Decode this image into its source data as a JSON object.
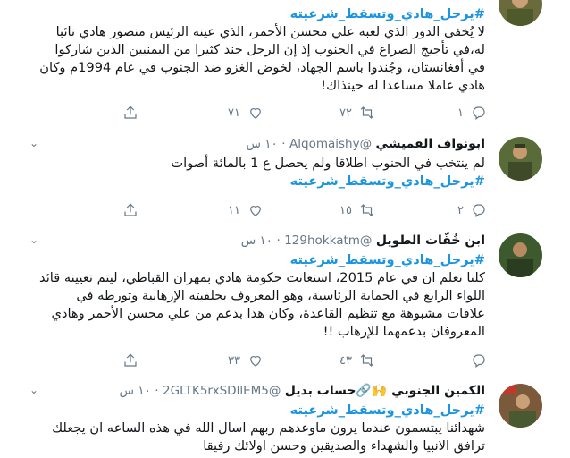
{
  "tweets": [
    {
      "name": "",
      "handle": "",
      "time": "",
      "hashtag": "#يرحل_هادي_وتسقط_شرعيته",
      "body": "لا يُخفى الدور الذي لعبه علي محسن الأحمر، الذي عينه الرئيس منصور هادي نائبا له،في تأجيج الصراع في الجنوب إذ إن الرجل جند كثيرا من اليمنيين الذين شاركوا في أفغانستان، وجُندوا باسم الجهاد، لخوض الغزو ضد الجنوب في عام 1994م وكان هادي عاملا مساعدا له حينذاك!",
      "body_after_hashtag": "",
      "reply_count": "١",
      "retweet_count": "٧٢",
      "like_count": "٧١",
      "avatar_color": "#6b6a3c"
    },
    {
      "name": "ابونواف القميشي",
      "handle": "@Alqomaishy",
      "time": "١٠ س",
      "hashtag": "#يرحل_هادي_وتسقط_شرعيته",
      "body": "لم ينتخب في الجنوب اطلاقا ولم يحصل ع 1 بالمائة أصوات",
      "body_after_hashtag": "",
      "reply_count": "٢",
      "retweet_count": "١٥",
      "like_count": "١١",
      "avatar_color": "#5a6b3a"
    },
    {
      "name": "ابن خُقّات الطويل",
      "handle": "@129hokkatm",
      "time": "١٠ س",
      "hashtag": "#يرحل_هادي_وتسقط_شرعيته",
      "body": "كلنا نعلم ان في عام 2015، استعانت حكومة هادي بمهران القباطي، ليتم تعيينه قائد اللواء الرابع في الحماية الرئاسية، وهو المعروف بخلفيته الإرهابية وتورطه في علاقات مشبوهة مع تنظيم القاعدة، وكان هذا بدعم من علي محسن الأحمر وهادي المعروفان بدعمهما للإرهاب !!",
      "body_after_hashtag": "",
      "reply_count": "",
      "retweet_count": "٤٣",
      "like_count": "٣٣",
      "avatar_color": "#3d5a2e"
    },
    {
      "name": "الكمين الجنوبي 🙌🔗حساب بديل",
      "handle": "@2GLTK5rxSDllEM5",
      "time": "١٠ س",
      "hashtag": "#يرحل_هادي_وتسقط_شرعيته",
      "body": "",
      "body_after_hashtag": "شهدائنا يبتسمون عندما يرون ماوعدهم ربهم اسال الله في هذه الساعه ان يجعلك ترافق الانبيا والشهداء والصديقين وحسن اولائك رفيقا",
      "reply_count": "",
      "retweet_count": "",
      "like_count": "",
      "avatar_color": "#7a5a3a"
    }
  ],
  "colors": {
    "hashtag": "#1b95e0",
    "secondary_text": "#657786",
    "divider": "#e6ecf0"
  },
  "icons": [
    "reply-icon",
    "retweet-icon",
    "like-icon",
    "share-icon",
    "chevron-down-icon"
  ]
}
